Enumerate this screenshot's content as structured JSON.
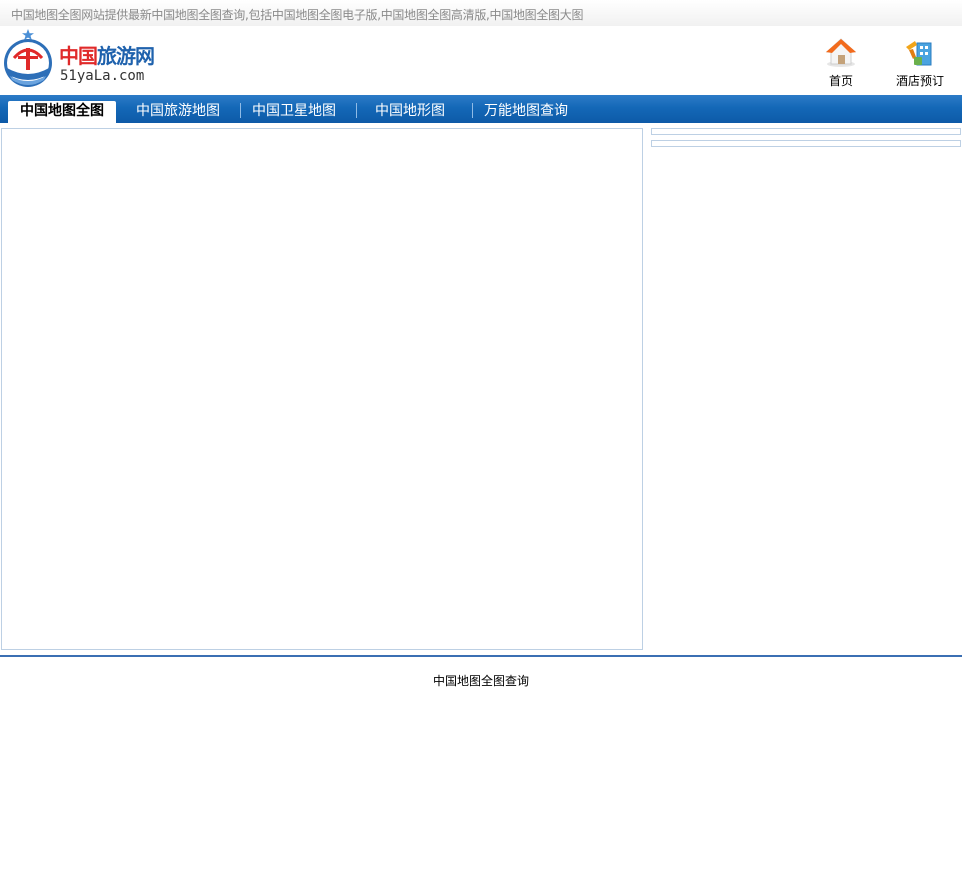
{
  "topbar": {
    "slogan": "中国地图全图网站提供最新中国地图全图查询,包括中国地图全图电子版,中国地图全图高清版,中国地图全图大图"
  },
  "logo": {
    "brand_part1": "中国",
    "brand_part2": "旅游网",
    "domain": "51yaLa.com"
  },
  "quick_links": [
    {
      "label": "首页",
      "icon": "house-icon"
    },
    {
      "label": "酒店预订",
      "icon": "hotel-booking-icon"
    }
  ],
  "nav": {
    "tabs": [
      {
        "label": "中国地图全图",
        "active": true
      },
      {
        "label": "中国旅游地图",
        "active": false
      },
      {
        "label": "中国卫星地图",
        "active": false
      },
      {
        "label": "中国地形图",
        "active": false
      },
      {
        "label": "万能地图查询",
        "active": false
      }
    ]
  },
  "footer": {
    "text": "中国地图全图查询"
  },
  "colors": {
    "nav_blue": "#1468b7",
    "brand_blue": "#1f62ad",
    "brand_red": "#e02a2a",
    "border": "#bdd0e4",
    "footer_line": "#3b6fb3"
  }
}
